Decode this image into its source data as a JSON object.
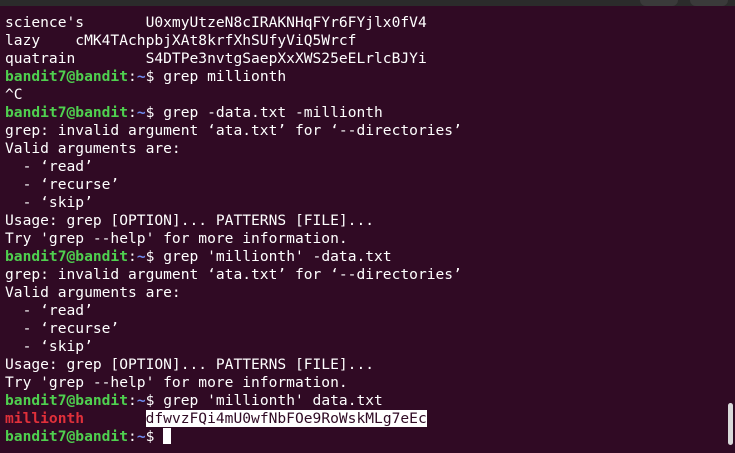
{
  "terminal": {
    "lines": [
      {
        "type": "text",
        "text": "science's       U0xmyUtzeN8cIRAKNHqFYr6FYjlx0fV4"
      },
      {
        "type": "text",
        "text": "lazy    cMK4TAchpbjXAt8krfXhSUfyViQ5Wrcf"
      },
      {
        "type": "text",
        "text": "quatrain        S4DTPe3nvtgSaepXxXWS25eELrlcBJYi"
      },
      {
        "type": "prompt",
        "user": "bandit7@bandit",
        "sep": ":",
        "path": "~",
        "sign": "$ ",
        "cmd": "grep millionth"
      },
      {
        "type": "text",
        "text": "^C"
      },
      {
        "type": "prompt",
        "user": "bandit7@bandit",
        "sep": ":",
        "path": "~",
        "sign": "$ ",
        "cmd": "grep -data.txt -millionth"
      },
      {
        "type": "text",
        "text": "grep: invalid argument ‘ata.txt’ for ‘--directories’"
      },
      {
        "type": "text",
        "text": "Valid arguments are:"
      },
      {
        "type": "text",
        "text": "  - ‘read’"
      },
      {
        "type": "text",
        "text": "  - ‘recurse’"
      },
      {
        "type": "text",
        "text": "  - ‘skip’"
      },
      {
        "type": "text",
        "text": "Usage: grep [OPTION]... PATTERNS [FILE]..."
      },
      {
        "type": "text",
        "text": "Try 'grep --help' for more information."
      },
      {
        "type": "prompt",
        "user": "bandit7@bandit",
        "sep": ":",
        "path": "~",
        "sign": "$ ",
        "cmd": "grep 'millionth' -data.txt"
      },
      {
        "type": "text",
        "text": "grep: invalid argument ‘ata.txt’ for ‘--directories’"
      },
      {
        "type": "text",
        "text": "Valid arguments are:"
      },
      {
        "type": "text",
        "text": "  - ‘read’"
      },
      {
        "type": "text",
        "text": "  - ‘recurse’"
      },
      {
        "type": "text",
        "text": "  - ‘skip’"
      },
      {
        "type": "text",
        "text": "Usage: grep [OPTION]... PATTERNS [FILE]..."
      },
      {
        "type": "text",
        "text": "Try 'grep --help' for more information."
      },
      {
        "type": "prompt",
        "user": "bandit7@bandit",
        "sep": ":",
        "path": "~",
        "sign": "$ ",
        "cmd": "grep 'millionth' data.txt"
      },
      {
        "type": "match",
        "match": "millionth",
        "gap": "       ",
        "value": "dfwvzFQi4mU0wfNbFOe9RoWskMLg7eEc"
      },
      {
        "type": "prompt",
        "user": "bandit7@bandit",
        "sep": ":",
        "path": "~",
        "sign": "$ ",
        "cmd": "",
        "cursor": true
      }
    ]
  },
  "colors": {
    "background": "#300a24",
    "prompt_user": "#4fd04f",
    "prompt_path": "#6f8cf0",
    "match": "#e0303a",
    "text": "#ffffff"
  }
}
